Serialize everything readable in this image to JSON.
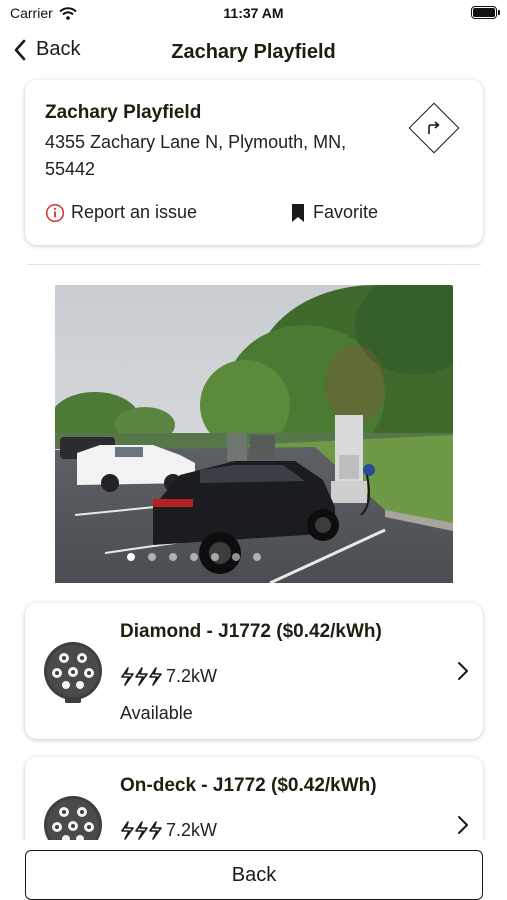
{
  "status_bar": {
    "carrier": "Carrier",
    "time": "11:37 AM"
  },
  "nav": {
    "back_label": "Back",
    "title": "Zachary Playfield"
  },
  "station": {
    "name": "Zachary Playfield",
    "address": "4355 Zachary Lane N, Plymouth, MN, 55442",
    "report_label": "Report an issue",
    "favorite_label": "Favorite"
  },
  "photo_gallery": {
    "page_count": 7,
    "current_page": 1
  },
  "connectors": [
    {
      "title": "Diamond - J1772 ($0.42/kWh)",
      "power": "7.2kW",
      "status": "Available",
      "icon": "j1772-connector-icon"
    },
    {
      "title": "On-deck - J1772 ($0.42/kWh)",
      "power": "7.2kW",
      "status": "",
      "icon": "j1772-connector-icon"
    }
  ],
  "footer": {
    "back_button_label": "Back"
  },
  "colors": {
    "title_text": "#1f1f10",
    "report_icon": "#d0312d",
    "card_shadow": "rgba(0,0,0,0.22)"
  }
}
